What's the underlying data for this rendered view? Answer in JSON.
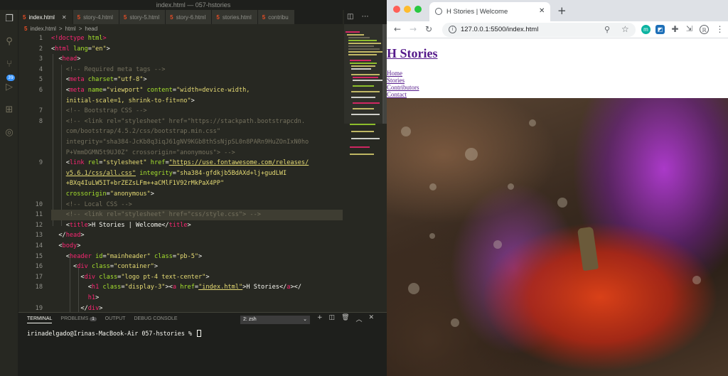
{
  "vscode": {
    "window_title": "index.html — 057-hstories",
    "tabs": [
      {
        "label": "index.html",
        "active": true
      },
      {
        "label": "story-4.html"
      },
      {
        "label": "story-5.html"
      },
      {
        "label": "story-6.html"
      },
      {
        "label": "stories.html"
      },
      {
        "label": "contribu"
      }
    ],
    "tab_file_badge": "5",
    "activity_badge": "39",
    "breadcrumb": [
      "index.html",
      "html",
      "head"
    ],
    "breadcrumb_sep": ">",
    "line_numbers": [
      "1",
      "2",
      "3",
      "4",
      "5",
      "6",
      "",
      "7",
      "8",
      "",
      "",
      "9",
      "",
      "",
      "10",
      "11",
      "12",
      "13",
      "14",
      "15",
      "16",
      "17",
      "18",
      "",
      "19"
    ],
    "code": {
      "l1_a": "<!",
      "l1_b": "doctype",
      "l1_c": " html",
      "l1_d": ">",
      "l2_a": "<",
      "l2_b": "html",
      "l2_c": " lang",
      "l2_d": "=",
      "l2_e": "\"en\"",
      "l2_f": ">",
      "l3": "head",
      "l4": "<!-- Required meta tags -->",
      "l5_tag": "meta",
      "l5_attr": "charset",
      "l5_val": "\"utf-8\"",
      "l6_tag": "meta",
      "l6_attr1": "name",
      "l6_val1": "\"viewport\"",
      "l6_attr2": "content",
      "l6_val2a": "\"width=device-width,",
      "l6_val2b": "initial-scale=1, shrink-to-fit=no\"",
      "l7": "<!-- Bootstrap CSS -->",
      "l8_a": "<!-- <link rel=\"stylesheet\" href=\"https://stackpath.bootstrapcdn.",
      "l8_b": "com/bootstrap/4.5.2/css/bootstrap.min.css\"",
      "l8_c": "integrity=\"sha384-JcKb8q3iqJ61gNV9KGb8thSsNjpSL0n8PARn9HuZOnIxN0ho",
      "l8_d": "P+VmmDGMN5t9UJ0Z\" crossorigin=\"anonymous\"> -->",
      "l9_tag": "link",
      "l9_attr1": "rel",
      "l9_val1": "\"stylesheet\"",
      "l9_attr2": "href",
      "l9_val2": "\"https://use.fontawesome.com/releases/",
      "l9_b_val": "v5.6.1/css/all.css\"",
      "l9_b_attr": "integrity",
      "l9_b_val2": "\"sha384-gfdkjb5BdAXd+lj+gudLWI",
      "l9_c": "+BXq4IuLW5IT+brZEZsLFm++aCMlF1V92rMkPaX4PP\"",
      "l9_d_attr": "crossorigin",
      "l9_d_val": "\"anonymous\"",
      "l10": "<!-- Local CSS -->",
      "l11": "<!-- <link rel=\"stylesheet\" href=\"css/style.css\"> -->",
      "l12_tag": "title",
      "l12_text": "H Stories | Welcome",
      "l13": "head",
      "l14": "body",
      "l15_tag": "header",
      "l15_attr1": "id",
      "l15_val1": "\"mainheader\"",
      "l15_attr2": "class",
      "l15_val2": "\"pb-5\"",
      "l16_tag": "div",
      "l16_attr": "class",
      "l16_val": "\"container\"",
      "l17_tag": "div",
      "l17_attr": "class",
      "l17_val": "\"logo pt-4 text-center\"",
      "l18_tag": "h1",
      "l18_attr": "class",
      "l18_val": "\"display-3\"",
      "l18_a": "a",
      "l18_href": "href",
      "l18_hval": "\"index.html\"",
      "l18_text": "H Stories",
      "l18_b": "h1",
      "l19": "div"
    },
    "panel": {
      "tabs": [
        "TERMINAL",
        "PROBLEMS",
        "OUTPUT",
        "DEBUG CONSOLE"
      ],
      "problems_count": "1",
      "terminal_select": "2: zsh",
      "prompt": "irinadelgado@Irinas-MacBook-Air 057-hstories % "
    }
  },
  "browser": {
    "tab_title": "H Stories | Welcome",
    "url": "127.0.0.1:5500/index.html",
    "page": {
      "title": "H Stories",
      "nav": [
        "Home",
        "Stories",
        "Contributors",
        "Contact"
      ]
    }
  },
  "colors": {
    "vscode_bg": "#272822",
    "browser_link": "#551a8b",
    "smoke": "#b44fe0",
    "pumpkin": "#e24218"
  }
}
